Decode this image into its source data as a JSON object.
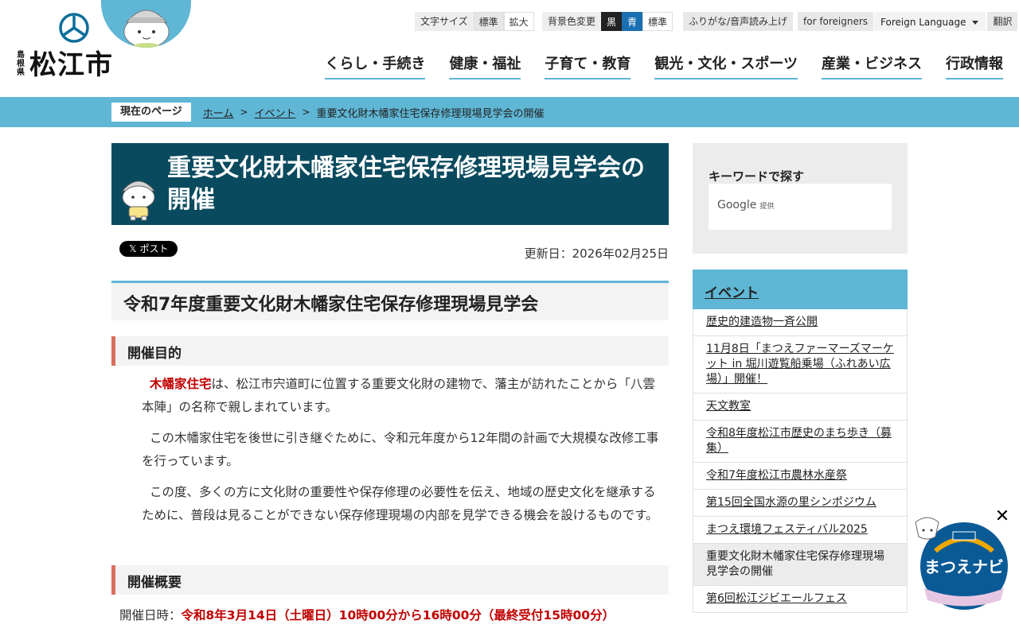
{
  "header": {
    "logo_pref": "島根県",
    "logo_city": "松江市",
    "util": {
      "font_size_label": "文字サイズ",
      "font_standard": "標準",
      "font_large": "拡大",
      "bg_label": "背景色変更",
      "bg_black": "黒",
      "bg_blue": "青",
      "bg_standard": "標準",
      "furigana": "ふりがな/音声読み上げ",
      "foreigners": "for foreigners",
      "language": "Foreign Language",
      "translate": "翻訳"
    },
    "gnav": [
      "くらし・手続き",
      "健康・福祉",
      "子育て・教育",
      "観光・文化・スポーツ",
      "産業・ビジネス",
      "行政情報"
    ]
  },
  "breadcrumb": {
    "label": "現在のページ",
    "home": "ホーム",
    "event": "イベント",
    "current": "重要文化財木幡家住宅保存修理現場見学会の開催"
  },
  "page": {
    "title": "重要文化財木幡家住宅保存修理現場見学会の開催",
    "post_button": "𝕏 ポスト",
    "updated": "更新日：2026年02月25日",
    "h2": "令和7年度重要文化財木幡家住宅保存修理現場見学会",
    "section1_heading": "開催目的",
    "p1_highlight": "木幡家住宅",
    "p1_rest": "は、松江市宍道町に位置する重要文化財の建物で、藩主が訪れたことから「八雲本陣」の名称で親しまれています。",
    "p2": "この木幡家住宅を後世に引き継ぐために、令和元年度から12年間の計画で大規模な改修工事を行っています。",
    "p3": "この度、多くの方に文化財の重要性や保存修理の必要性を伝え、地域の歴史文化を継承するために、普段は見ることができない保存修理現場の内部を見学できる機会を設けるものです。",
    "section2_heading": "開催概要",
    "date_label": "開催日時：",
    "date_value": "令和8年3月14日（土曜日）10時00分から16時00分（最終受付15時00分）"
  },
  "sidebar": {
    "search_heading": "キーワードで探す",
    "google_label": "Google",
    "google_provided": "提供",
    "nav_heading": "イベント",
    "items": [
      "歴史的建造物一斉公開",
      "11月8日「まつえファーマーズマーケット in 堀川遊覧船乗場（ふれあい広場）」開催！",
      "天文教室",
      "令和8年度松江市歴史のまち歩き（募集）",
      "令和7年度松江市農林水産祭",
      "第15回全国水源の里シンポジウム",
      "まつえ環境フェスティバル2025",
      "重要文化財木幡家住宅保存修理現場見学会の開催",
      "第6回松江ジビエールフェス"
    ]
  },
  "floating": {
    "close": "✕",
    "navi_label": "まつえナビ"
  },
  "colors": {
    "accent": "#5fb6d5",
    "title_bg": "#0a4a5e",
    "heading_mark": "#d9705c",
    "highlight": "#c00000"
  }
}
